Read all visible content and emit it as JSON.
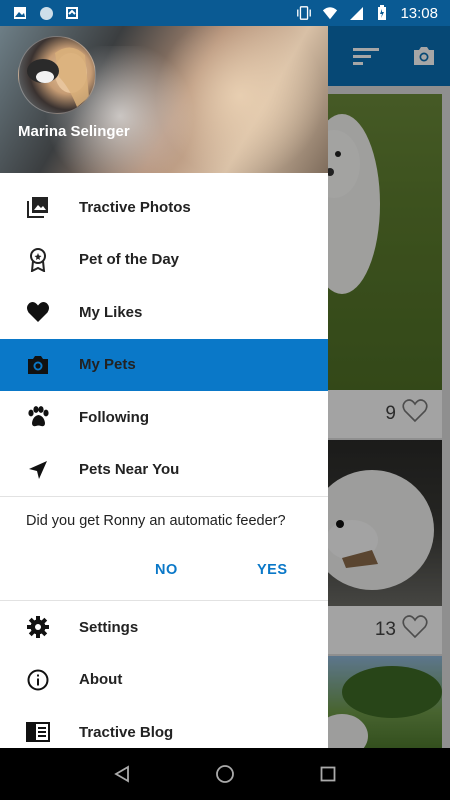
{
  "status_bar": {
    "time": "13:08",
    "icons_left": [
      "image-icon",
      "circle-icon",
      "sync-icon"
    ],
    "icons_right": [
      "vibrate-icon",
      "wifi-icon",
      "signal-icon",
      "battery-icon"
    ]
  },
  "drawer": {
    "user_name": "Marina Selinger",
    "menu_items": [
      {
        "label": "Tractive Photos",
        "icon": "photo-library-icon"
      },
      {
        "label": "Pet of the Day",
        "icon": "award-icon"
      },
      {
        "label": "My Likes",
        "icon": "heart-icon"
      },
      {
        "label": "My Pets",
        "icon": "camera-icon",
        "active": true
      },
      {
        "label": "Following",
        "icon": "paw-icon"
      },
      {
        "label": "Pets Near You",
        "icon": "navigation-icon"
      }
    ],
    "prompt": {
      "question": "Did you get Ronny an automatic feeder?",
      "no_label": "NO",
      "yes_label": "YES"
    },
    "footer_items": [
      {
        "label": "Settings",
        "icon": "gear-icon"
      },
      {
        "label": "About",
        "icon": "info-icon"
      },
      {
        "label": "Tractive Blog",
        "icon": "blog-icon"
      }
    ]
  },
  "background": {
    "cards": [
      {
        "likes": "9"
      },
      {
        "likes": "13"
      }
    ]
  },
  "colors": {
    "status_bar": "#0a5a93",
    "toolbar": "#0a6fb4",
    "accent": "#0a78c8"
  }
}
